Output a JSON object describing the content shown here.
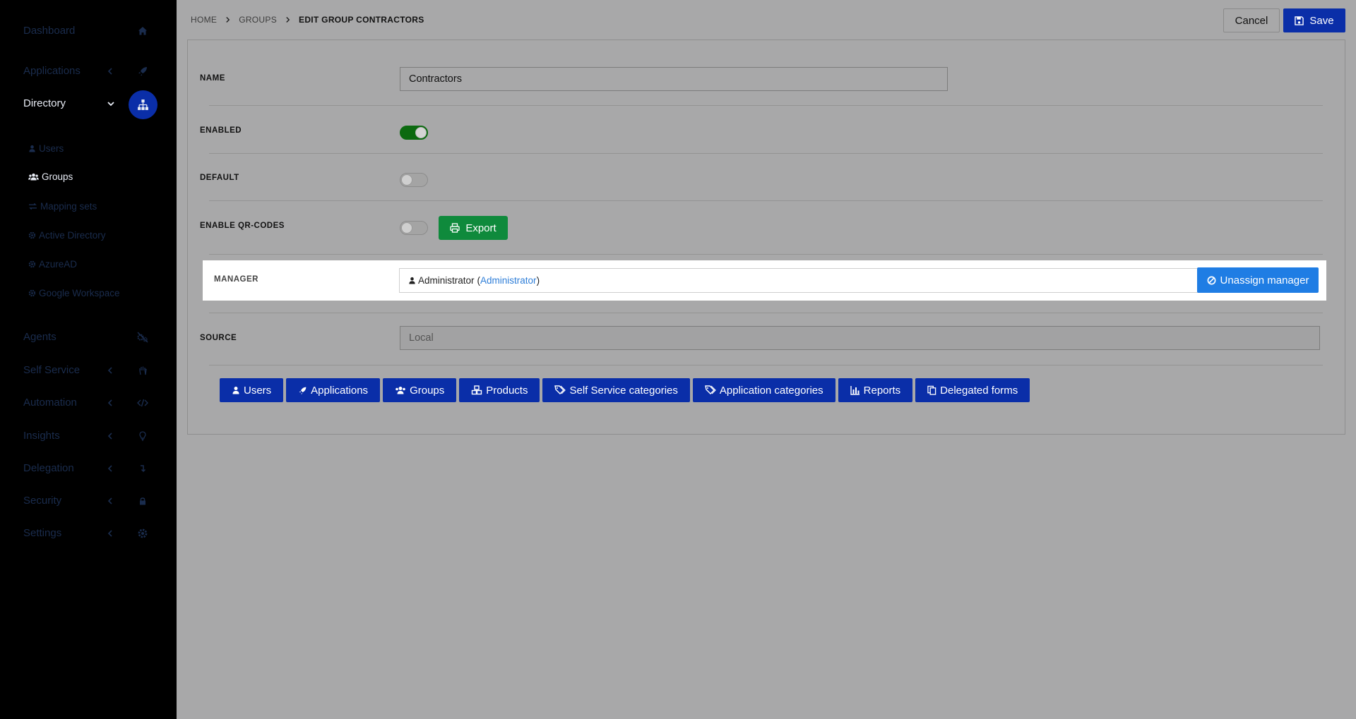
{
  "sidebar": {
    "items": [
      {
        "label": "Dashboard",
        "icon": "home-icon"
      },
      {
        "label": "Applications",
        "icon": "rocket-icon"
      },
      {
        "label": "Directory",
        "icon": "sitemap-icon"
      },
      {
        "label": "Agents",
        "icon": "agents-icon"
      },
      {
        "label": "Self Service",
        "icon": "hand-icon"
      },
      {
        "label": "Automation",
        "icon": "code-icon"
      },
      {
        "label": "Insights",
        "icon": "lightbulb-icon"
      },
      {
        "label": "Delegation",
        "icon": "delegation-icon"
      },
      {
        "label": "Security",
        "icon": "lock-icon"
      },
      {
        "label": "Settings",
        "icon": "gear-icon"
      }
    ],
    "directory_sub": [
      {
        "label": "Users",
        "icon": "user-icon"
      },
      {
        "label": "Groups",
        "icon": "users-icon"
      },
      {
        "label": "Mapping sets",
        "icon": "exchange-icon"
      },
      {
        "label": "Active Directory",
        "icon": "gear-icon"
      },
      {
        "label": "AzureAD",
        "icon": "gear-icon"
      },
      {
        "label": "Google Workspace",
        "icon": "gear-icon"
      }
    ]
  },
  "breadcrumb": {
    "home": "HOME",
    "groups": "GROUPS",
    "current": "EDIT GROUP CONTRACTORS"
  },
  "toolbar": {
    "cancel_label": "Cancel",
    "save_label": "Save"
  },
  "form": {
    "name_label": "NAME",
    "name_value": "Contractors",
    "enabled_label": "ENABLED",
    "enabled_value": true,
    "default_label": "DEFAULT",
    "default_value": false,
    "qr_label": "ENABLE QR-CODES",
    "qr_value": false,
    "export_label": "Export",
    "manager_label": "MANAGER",
    "manager_name": "Administrator",
    "manager_open_paren": "(",
    "manager_link": "Administrator",
    "manager_close_paren": ")",
    "unassign_label": "Unassign manager",
    "source_label": "SOURCE",
    "source_value": "Local"
  },
  "tabs": [
    {
      "label": "Users",
      "icon": "user-icon"
    },
    {
      "label": "Applications",
      "icon": "rocket-icon"
    },
    {
      "label": "Groups",
      "icon": "users-icon"
    },
    {
      "label": "Products",
      "icon": "cubes-icon"
    },
    {
      "label": "Self Service categories",
      "icon": "tags-icon"
    },
    {
      "label": "Application categories",
      "icon": "tags-icon"
    },
    {
      "label": "Reports",
      "icon": "bar-chart-icon"
    },
    {
      "label": "Delegated forms",
      "icon": "copy-icon"
    }
  ],
  "colors": {
    "primary": "#0a2ea8",
    "unassign": "#1f7de4",
    "export": "#0f8a3c",
    "toggle_on": "#0c6a10",
    "link": "#2e7ed8"
  }
}
